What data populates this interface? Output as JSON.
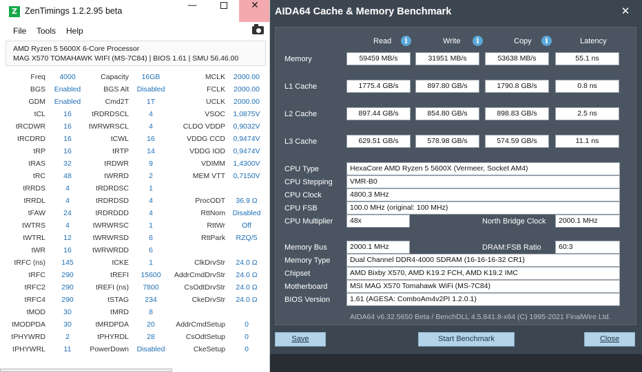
{
  "zentimings": {
    "title": "ZenTimings 1.2.2.95 beta",
    "logo_letter": "Z",
    "window_controls": {
      "minimize": "—",
      "close": "✕"
    },
    "menu": [
      "File",
      "Tools",
      "Help"
    ],
    "cpu_name": "AMD Ryzen 5 5600X 6-Core Processor",
    "board_line": "MAG X570 TOMAHAWK WIFI (MS-7C84) | BIOS 1.61 | SMU 56.46.00",
    "rows": [
      [
        "Freq",
        "4000",
        "Capacity",
        "16GB",
        "MCLK",
        "2000.00"
      ],
      [
        "BGS",
        "Enabled",
        "BGS Alt",
        "Disabled",
        "FCLK",
        "2000.00"
      ],
      [
        "GDM",
        "Enabled",
        "Cmd2T",
        "1T",
        "UCLK",
        "2000.00"
      ],
      [
        "tCL",
        "16",
        "tRDRDSCL",
        "4",
        "VSOC",
        "1,0875V"
      ],
      [
        "tRCDWR",
        "16",
        "tWRWRSCL",
        "4",
        "CLDO VDDP",
        "0,9032V"
      ],
      [
        "tRCDRD",
        "16",
        "tCWL",
        "16",
        "VDDG CCD",
        "0,9474V"
      ],
      [
        "tRP",
        "16",
        "tRTP",
        "14",
        "VDDG IOD",
        "0,9474V"
      ],
      [
        "tRAS",
        "32",
        "tRDWR",
        "9",
        "VDIMM",
        "1,4300V"
      ],
      [
        "tRC",
        "48",
        "tWRRD",
        "2",
        "MEM VTT",
        "0,7150V"
      ],
      [
        "tRRDS",
        "4",
        "tRDRDSC",
        "1",
        "",
        ""
      ],
      [
        "tRRDL",
        "4",
        "tRDRDSD",
        "4",
        "ProcODT",
        "36.9 Ω"
      ],
      [
        "tFAW",
        "24",
        "tRDRDDD",
        "4",
        "RttNom",
        "Disabled"
      ],
      [
        "tWTRS",
        "4",
        "tWRWRSC",
        "1",
        "RttWr",
        "Off"
      ],
      [
        "tWTRL",
        "12",
        "tWRWRSD",
        "6",
        "RttPark",
        "RZQ/5"
      ],
      [
        "tWR",
        "16",
        "tWRWRDD",
        "6",
        "",
        ""
      ],
      [
        "tRFC (ns)",
        "145",
        "tCKE",
        "1",
        "ClkDrvStr",
        "24.0 Ω"
      ],
      [
        "tRFC",
        "290",
        "tREFI",
        "15600",
        "AddrCmdDrvStr",
        "24.0 Ω"
      ],
      [
        "tRFC2",
        "290",
        "tREFI (ns)",
        "7800",
        "CsOdtDrvStr",
        "24.0 Ω"
      ],
      [
        "tRFC4",
        "290",
        "tSTAG",
        "234",
        "CkeDrvStr",
        "24.0 Ω"
      ],
      [
        "tMOD",
        "30",
        "tMRD",
        "8",
        "",
        ""
      ],
      [
        "tMODPDA",
        "30",
        "tMRDPDA",
        "20",
        "AddrCmdSetup",
        "0"
      ],
      [
        "tPHYWRD",
        "2",
        "tPHYRDL",
        "28",
        "CsOdtSetup",
        "0"
      ],
      [
        "tPHYWRL",
        "11",
        "PowerDown",
        "Disabled",
        "CkeSetup",
        "0"
      ]
    ]
  },
  "aida": {
    "title": "AIDA64 Cache & Memory Benchmark",
    "close_glyph": "✕",
    "headers": {
      "read": "Read",
      "write": "Write",
      "copy": "Copy",
      "latency": "Latency"
    },
    "info_glyph": "i",
    "bench": [
      {
        "label": "Memory",
        "read": "59459 MB/s",
        "write": "31951 MB/s",
        "copy": "53638 MB/s",
        "latency": "55.1 ns"
      },
      {
        "label": "L1 Cache",
        "read": "1775.4 GB/s",
        "write": "897.80 GB/s",
        "copy": "1790.8 GB/s",
        "latency": "0.8 ns"
      },
      {
        "label": "L2 Cache",
        "read": "897.44 GB/s",
        "write": "854.80 GB/s",
        "copy": "898.83 GB/s",
        "latency": "2.5 ns"
      },
      {
        "label": "L3 Cache",
        "read": "629.51 GB/s",
        "write": "578.98 GB/s",
        "copy": "574.59 GB/s",
        "latency": "11.1 ns"
      }
    ],
    "cpu_type_label": "CPU Type",
    "cpu_type": "HexaCore AMD Ryzen 5 5600X  (Vermeer, Socket AM4)",
    "cpu_stepping_label": "CPU Stepping",
    "cpu_stepping": "VMR-B0",
    "cpu_clock_label": "CPU Clock",
    "cpu_clock": "4800.3 MHz",
    "cpu_fsb_label": "CPU FSB",
    "cpu_fsb": "100.0 MHz  (original: 100 MHz)",
    "cpu_mult_label": "CPU Multiplier",
    "cpu_mult": "48x",
    "nb_clock_label": "North Bridge Clock",
    "nb_clock": "2000.1 MHz",
    "mem_bus_label": "Memory Bus",
    "mem_bus": "2000.1 MHz",
    "dram_ratio_label": "DRAM:FSB Ratio",
    "dram_ratio": "60:3",
    "mem_type_label": "Memory Type",
    "mem_type": "Dual Channel DDR4-4000 SDRAM  (16-16-16-32 CR1)",
    "chipset_label": "Chipset",
    "chipset": "AMD Bixby X570, AMD K19.2 FCH, AMD K19.2 IMC",
    "mobo_label": "Motherboard",
    "mobo": "MSI MAG X570 Tomahawk WiFi (MS-7C84)",
    "bios_label": "BIOS Version",
    "bios": "1.61  (AGESA: ComboAm4v2PI 1.2.0.1)",
    "footer": "AIDA64 v6.32.5650 Beta / BenchDLL 4.5.841.8-x64  (C) 1995-2021 FinalWire Ltd.",
    "buttons": {
      "save": "Save",
      "start": "Start Benchmark",
      "close": "Close"
    }
  }
}
